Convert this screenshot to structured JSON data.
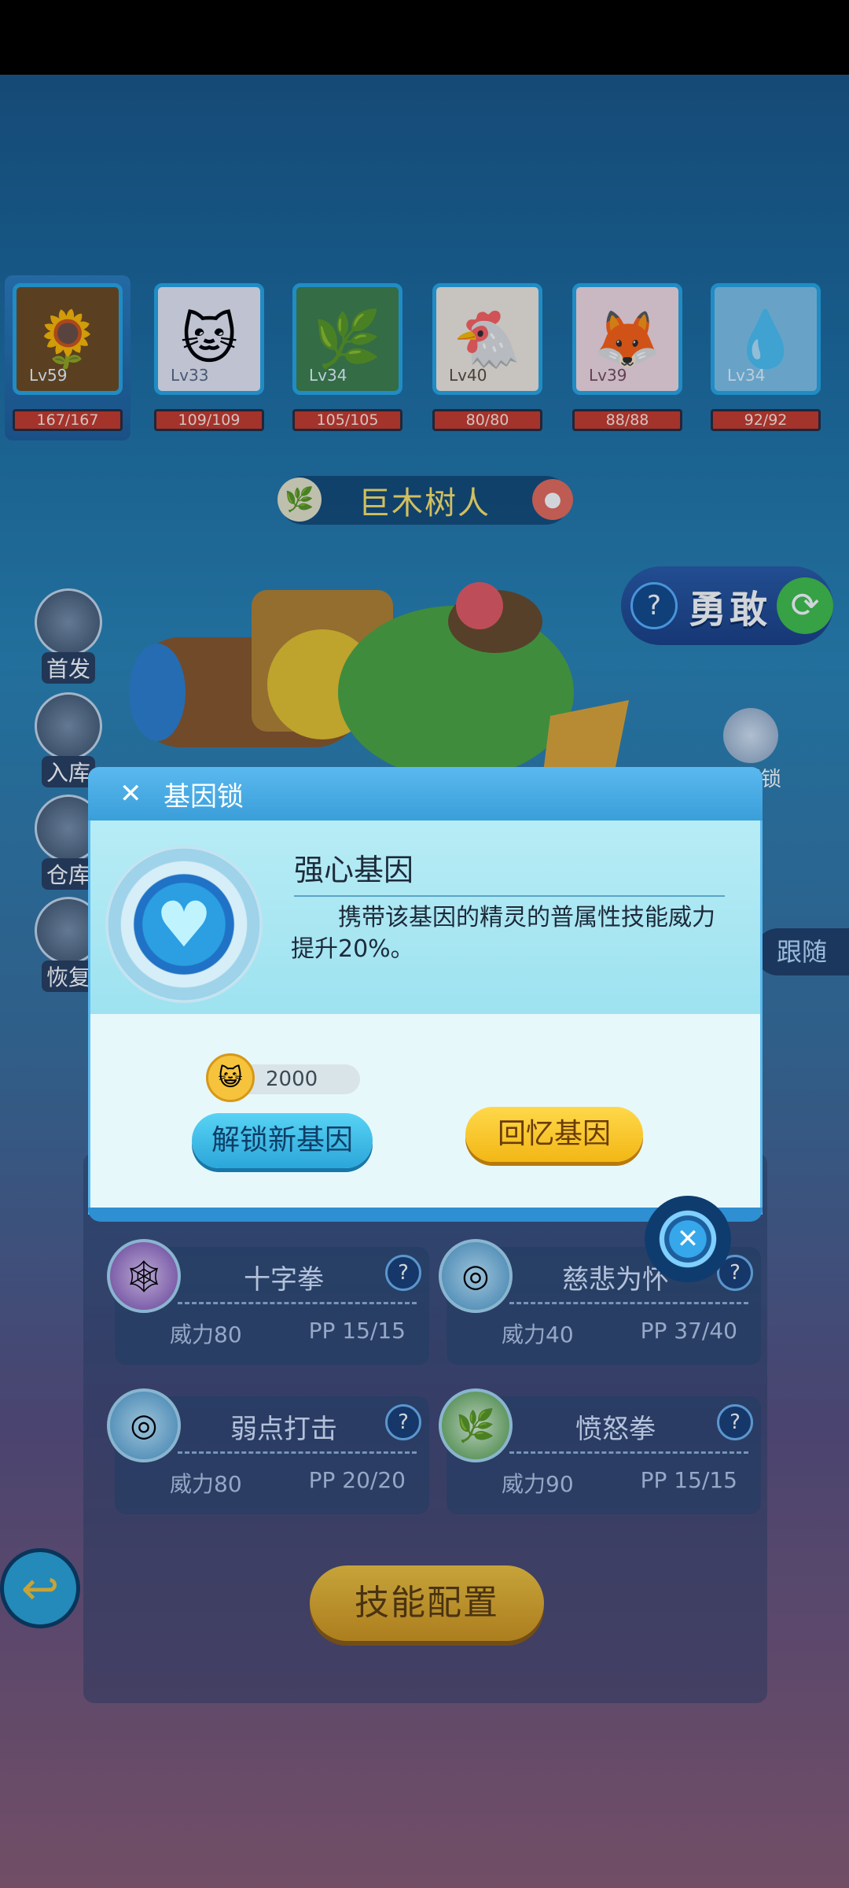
{
  "team": [
    {
      "level": "Lv59",
      "hp": "167/167",
      "face": "🌻",
      "active": true
    },
    {
      "level": "Lv33",
      "hp": "109/109",
      "face": "🐱"
    },
    {
      "level": "Lv34",
      "hp": "105/105",
      "face": "🌿"
    },
    {
      "level": "Lv40",
      "hp": "80/80",
      "face": "🐔"
    },
    {
      "level": "Lv39",
      "hp": "88/88",
      "face": "🦊"
    },
    {
      "level": "Lv34",
      "hp": "92/92",
      "face": "💧"
    }
  ],
  "pet": {
    "name": "巨木树人",
    "element_icon": "leaf-icon",
    "pet_icon": "pet-badge-icon"
  },
  "side_buttons": [
    "首发",
    "入库",
    "仓库",
    "恢复"
  ],
  "right_buttons": {
    "brave": "勇敢",
    "gene_lock": "基因锁",
    "follow": "跟随"
  },
  "skills": [
    {
      "name": "十字拳",
      "power": "威力80",
      "pp": "PP 15/15",
      "icon": "🕸"
    },
    {
      "name": "慈悲为怀",
      "power": "威力40",
      "pp": "PP 37/40",
      "icon": "◎"
    },
    {
      "name": "弱点打击",
      "power": "威力80",
      "pp": "PP 20/20",
      "icon": "◎"
    },
    {
      "name": "愤怒拳",
      "power": "威力90",
      "pp": "PP 15/15",
      "icon": "🌿"
    }
  ],
  "config_button": "技能配置",
  "modal": {
    "title": "基因锁",
    "gene_name": "强心基因",
    "gene_desc": "携带该基因的精灵的普属性技能威力提升20%。",
    "cost": "2000",
    "unlock_label": "解锁新基因",
    "recall_label": "回忆基因"
  },
  "colors": {
    "accent_blue": "#3a9ed9",
    "gold_button": "#f2b715",
    "hp_red": "#c83a2a"
  }
}
